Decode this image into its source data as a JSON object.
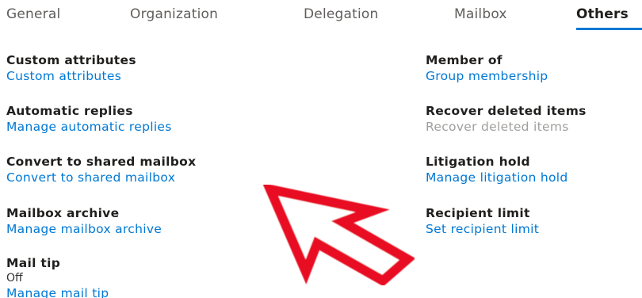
{
  "tabs": [
    {
      "label": "General"
    },
    {
      "label": "Organization"
    },
    {
      "label": "Delegation"
    },
    {
      "label": "Mailbox"
    },
    {
      "label": "Others"
    }
  ],
  "active_tab": "Others",
  "left": [
    {
      "heading": "Custom attributes",
      "link": "Custom attributes"
    },
    {
      "heading": "Automatic replies",
      "link": "Manage automatic replies"
    },
    {
      "heading": "Convert to shared mailbox",
      "link": "Convert to shared mailbox"
    },
    {
      "heading": "Mailbox archive",
      "link": "Manage mailbox archive"
    },
    {
      "heading": "Mail tip",
      "value": "Off",
      "link": "Manage mail tip"
    }
  ],
  "right": [
    {
      "heading": "Member of",
      "link": "Group membership"
    },
    {
      "heading": "Recover deleted items",
      "link": "Recover deleted items"
    },
    {
      "heading": "Litigation hold",
      "link": "Manage litigation hold"
    },
    {
      "heading": "Recipient limit",
      "link": "Set recipient limit"
    }
  ],
  "colors": {
    "accent": "#0078d4",
    "arrow": "#e81123"
  }
}
